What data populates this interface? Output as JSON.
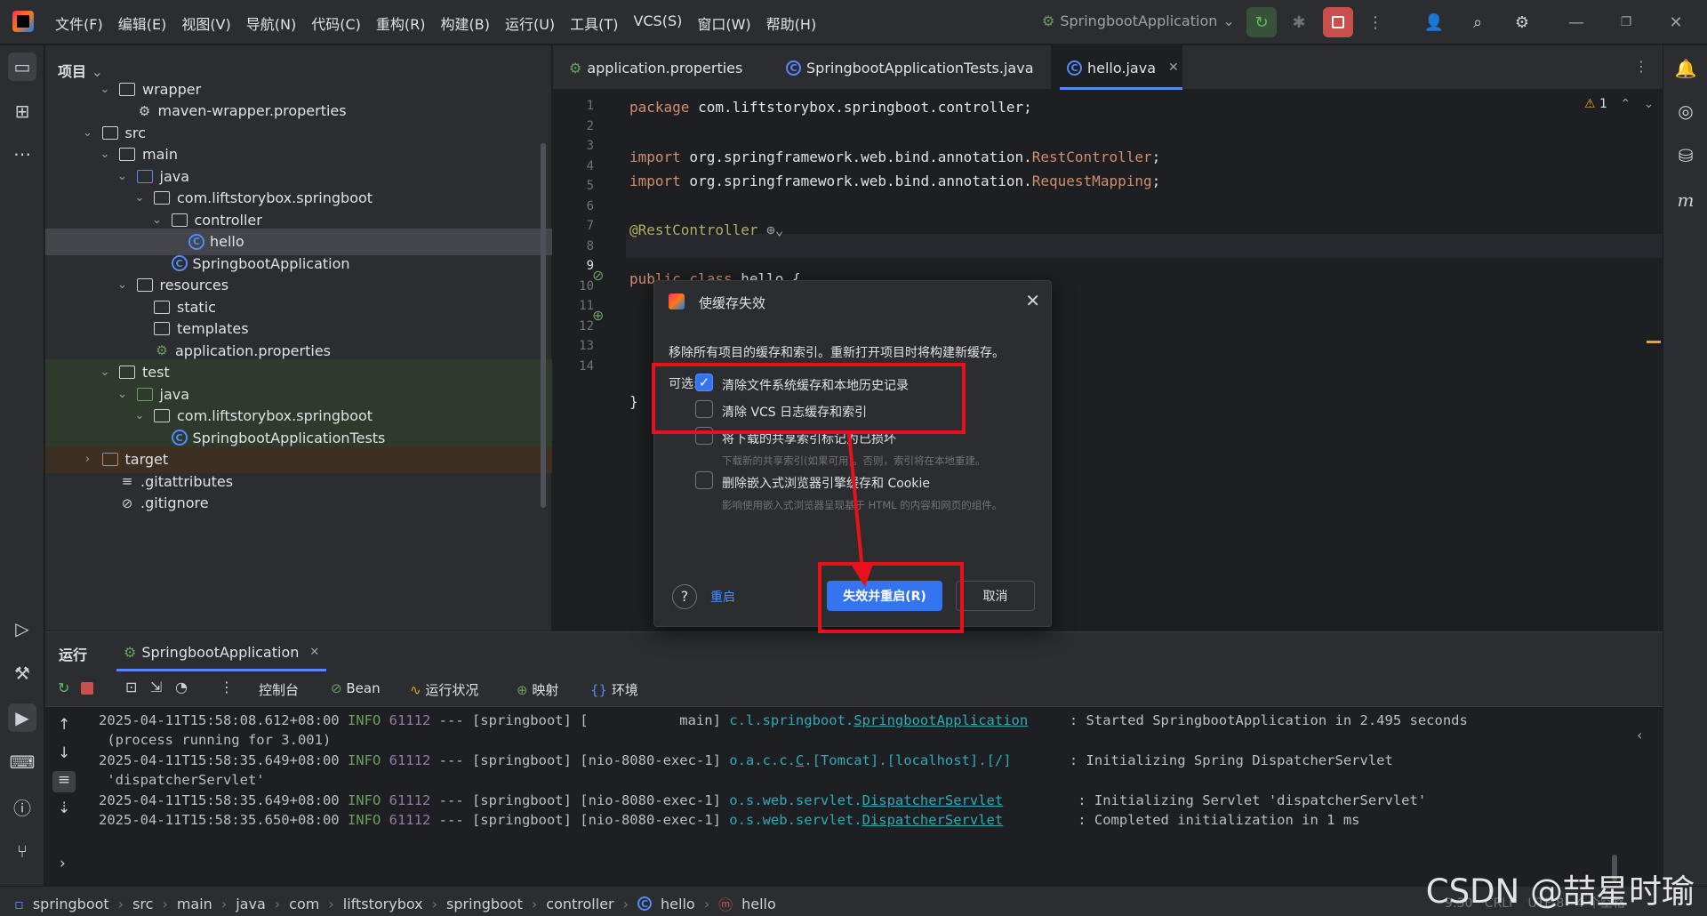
{
  "titlebar": {
    "menu": [
      "文件(F)",
      "编辑(E)",
      "视图(V)",
      "导航(N)",
      "代码(C)",
      "重构(R)",
      "构建(B)",
      "运行(U)",
      "工具(T)",
      "VCS(S)",
      "窗口(W)",
      "帮助(H)"
    ],
    "run_config": "SpringbootApplication"
  },
  "project": {
    "header": "项目",
    "tree": [
      {
        "label": "wrapper",
        "depth": 2,
        "kind": "folder",
        "expanded": true
      },
      {
        "label": "maven-wrapper.properties",
        "depth": 3,
        "kind": "gear"
      },
      {
        "label": "src",
        "depth": 1,
        "kind": "folder",
        "expanded": true
      },
      {
        "label": "main",
        "depth": 2,
        "kind": "folder",
        "expanded": true
      },
      {
        "label": "java",
        "depth": 3,
        "kind": "folder-blue",
        "expanded": true
      },
      {
        "label": "com.liftstorybox.springboot",
        "depth": 4,
        "kind": "package",
        "expanded": true
      },
      {
        "label": "controller",
        "depth": 5,
        "kind": "package",
        "expanded": true
      },
      {
        "label": "hello",
        "depth": 6,
        "kind": "class",
        "selected": true
      },
      {
        "label": "SpringbootApplication",
        "depth": 5,
        "kind": "class"
      },
      {
        "label": "resources",
        "depth": 3,
        "kind": "folder",
        "expanded": true
      },
      {
        "label": "static",
        "depth": 4,
        "kind": "folder"
      },
      {
        "label": "templates",
        "depth": 4,
        "kind": "folder"
      },
      {
        "label": "application.properties",
        "depth": 4,
        "kind": "leaf-spring"
      },
      {
        "label": "test",
        "depth": 2,
        "kind": "folder",
        "expanded": true
      },
      {
        "label": "java",
        "depth": 3,
        "kind": "folder-green",
        "expanded": true
      },
      {
        "label": "com.liftstorybox.springboot",
        "depth": 4,
        "kind": "package",
        "expanded": true
      },
      {
        "label": "SpringbootApplicationTests",
        "depth": 5,
        "kind": "class"
      },
      {
        "label": "target",
        "depth": 1,
        "kind": "folder-orange",
        "expanded": false
      },
      {
        "label": ".gitattributes",
        "depth": 2,
        "kind": "lines"
      },
      {
        "label": ".gitignore",
        "depth": 2,
        "kind": "circle"
      }
    ]
  },
  "editor": {
    "tabs": [
      "application.properties",
      "SpringbootApplicationTests.java",
      "hello.java"
    ],
    "active_tab": "hello.java",
    "warning_count": "1",
    "line_numbers": [
      "1",
      "2",
      "3",
      "4",
      "5",
      "6",
      "7",
      "8",
      "9",
      "10",
      "11",
      "12",
      "13",
      "14"
    ],
    "code": {
      "l1_kw": "package",
      "l1": " com.liftstorybox.springboot.controller;",
      "l3_kw": "import",
      "l3": " org.springframework.web.bind.annotation.",
      "l3_cls": "RestController",
      "l4_kw": "import",
      "l4": " org.springframework.web.bind.annotation.",
      "l4_cls": "RequestMapping",
      "l6": "@RestController",
      "l8_kw": "public class",
      "l8": " hello {",
      "l13": "}"
    }
  },
  "dialog": {
    "title": "使缓存失效",
    "description": "移除所有项目的缓存和索引。重新打开项目时将构建新缓存。",
    "optional_label": "可选:",
    "options": [
      {
        "label": "清除文件系统缓存和本地历史记录",
        "checked": true,
        "hint": ""
      },
      {
        "label": "清除 VCS 日志缓存和索引",
        "checked": false,
        "hint": ""
      },
      {
        "label": "将下载的共享索引标记为已损坏",
        "checked": false,
        "hint": "下载新的共享索引(如果可用)。否则，索引将在本地重建。"
      },
      {
        "label": "删除嵌入式浏览器引擎缓存和 Cookie",
        "checked": false,
        "hint": "影响使用嵌入式浏览器呈现基于 HTML 的内容和网页的组件。"
      }
    ],
    "restart_link": "重启",
    "primary_button": "失效并重启(R)",
    "cancel_button": "取消"
  },
  "run": {
    "label": "运行",
    "tab": "SpringbootApplication",
    "toolbar_tabs": [
      "控制台",
      "Bean",
      "运行状况",
      "映射",
      "环境"
    ],
    "log": [
      {
        "ts": "2025-04-11T15:58:08.612+08:00",
        "lvl": "INFO",
        "pid": "61112",
        "mid": " --- [springboot] [           main] ",
        "lg_prefix": "c.l.springboot.",
        "lg_link": "SpringbootApplication",
        "pad": "     ",
        "msg": ": Started SpringbootApplication in 2.495 seconds"
      },
      {
        "cont": " (process running for 3.001)"
      },
      {
        "ts": "2025-04-11T15:58:35.649+08:00",
        "lvl": "INFO",
        "pid": "61112",
        "mid": " --- [springboot] [nio-8080-exec-1] ",
        "lg_prefix": "o.a.c.c.",
        "lg_link": "C",
        "lg_suffix": ".[Tomcat].[localhost].[/]",
        "pad": "       ",
        "msg": ": Initializing Spring DispatcherServlet"
      },
      {
        "cont": " 'dispatcherServlet'"
      },
      {
        "ts": "2025-04-11T15:58:35.649+08:00",
        "lvl": "INFO",
        "pid": "61112",
        "mid": " --- [springboot] [nio-8080-exec-1] ",
        "lg_prefix": "o.s.web.servlet.",
        "lg_link": "DispatcherServlet",
        "pad": "         ",
        "msg": ": Initializing Servlet 'dispatcherServlet'"
      },
      {
        "ts": "2025-04-11T15:58:35.650+08:00",
        "lvl": "INFO",
        "pid": "61112",
        "mid": " --- [springboot] [nio-8080-exec-1] ",
        "lg_prefix": "o.s.web.servlet.",
        "lg_link": "DispatcherServlet",
        "pad": "         ",
        "msg": ": Completed initialization in 1 ms"
      }
    ]
  },
  "statusbar": {
    "breadcrumb": [
      "springboot",
      "src",
      "main",
      "java",
      "com",
      "liftstorybox",
      "springboot",
      "controller",
      "hello",
      "hello"
    ],
    "right": "9:30   CRLF   UTF-8   4 个空格"
  },
  "watermark": "CSDN @喆星时瑜",
  "colors": {
    "accent": "#3574f0",
    "highlight_box": "#e8101a",
    "arrow": "#e8101a"
  }
}
